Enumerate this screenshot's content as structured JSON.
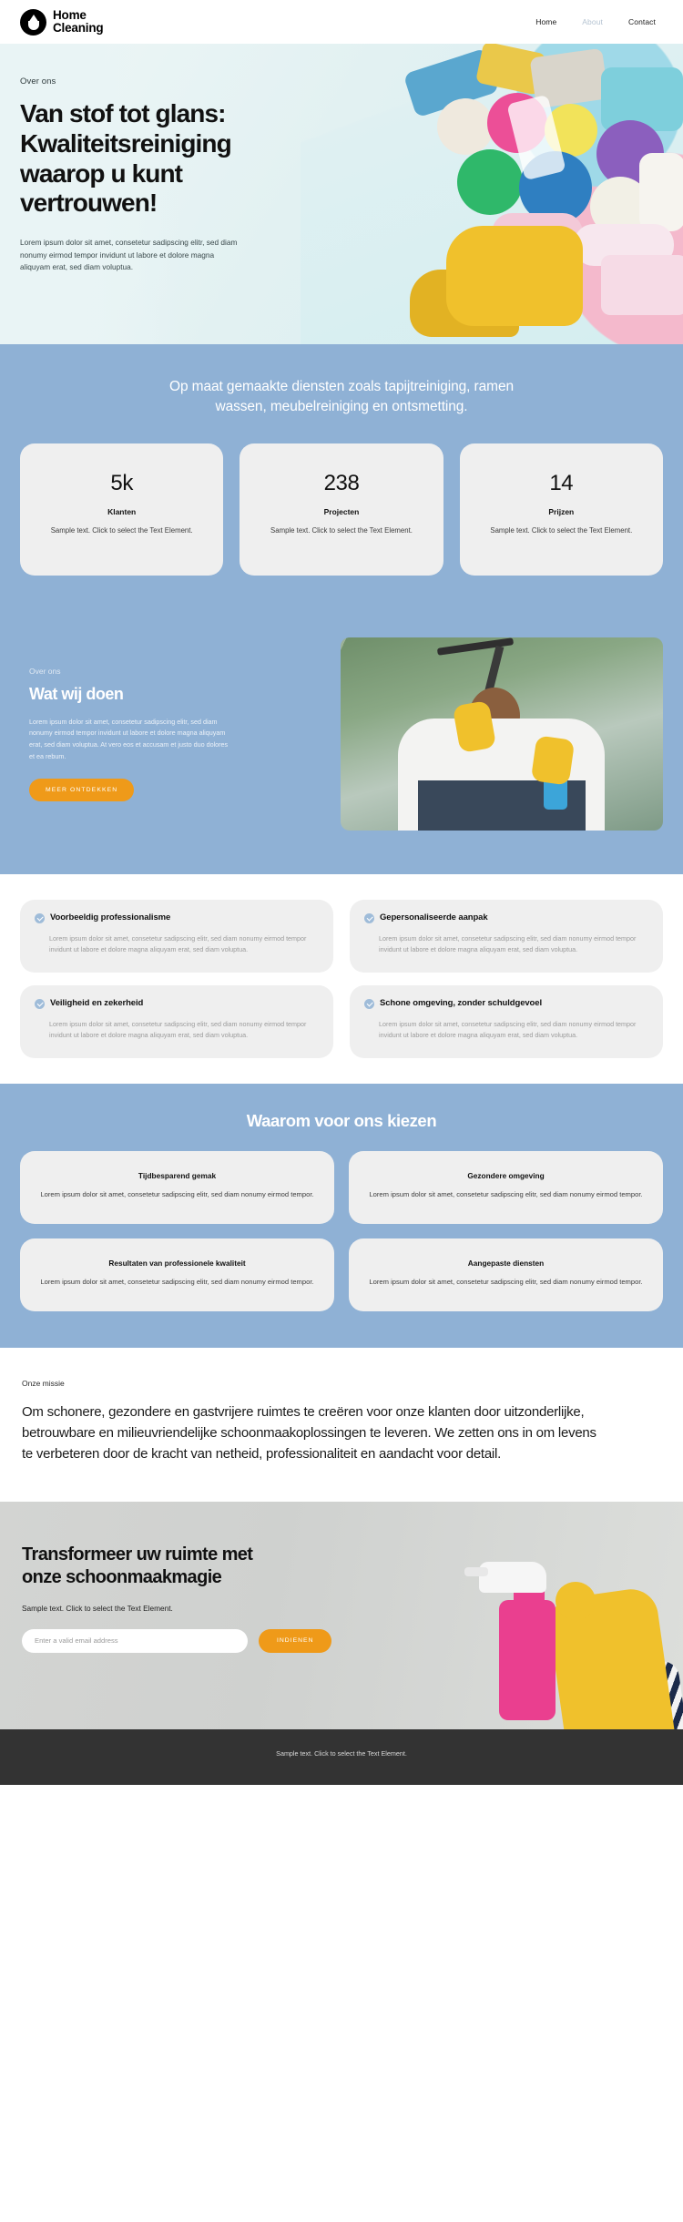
{
  "header": {
    "logo": {
      "line1": "Home",
      "line2": "Cleaning",
      "icon": "water-drop-icon"
    },
    "nav": [
      {
        "label": "Home",
        "active": false
      },
      {
        "label": "About",
        "active": true
      },
      {
        "label": "Contact",
        "active": false
      }
    ]
  },
  "hero": {
    "eyebrow": "Over ons",
    "title": "Van stof tot glans: Kwaliteitsreiniging waarop u kunt vertrouwen!",
    "paragraph": "Lorem ipsum dolor sit amet, consetetur sadipscing elitr, sed diam nonumy eirmod tempor invidunt ut labore et dolore magna aliquyam erat, sed diam voluptua."
  },
  "stats_band": {
    "title": "Op maat gemaakte diensten zoals tapijtreiniging, ramen wassen, meubelreiniging en ontsmetting.",
    "cards": [
      {
        "number": "5k",
        "label": "Klanten",
        "desc": "Sample text. Click to select the Text Element."
      },
      {
        "number": "238",
        "label": "Projecten",
        "desc": "Sample text. Click to select the Text Element."
      },
      {
        "number": "14",
        "label": "Prijzen",
        "desc": "Sample text. Click to select the Text Element."
      }
    ]
  },
  "about": {
    "eyebrow": "Over ons",
    "title": "Wat wij doen",
    "paragraph": "Lorem ipsum dolor sit amet, consetetur sadipscing elitr, sed diam nonumy eirmod tempor invidunt ut labore et dolore magna aliquyam erat, sed diam voluptua. At vero eos et accusam et justo duo dolores et ea rebum.",
    "button": "MEER ONTDEKKEN",
    "image": "window-cleaner-squeegee-photo"
  },
  "features": [
    {
      "title": "Voorbeeldig professionalisme",
      "body": "Lorem ipsum dolor sit amet, consetetur sadipscing elitr, sed diam nonumy eirmod tempor invidunt ut labore et dolore magna aliquyam erat, sed diam voluptua."
    },
    {
      "title": "Gepersonaliseerde aanpak",
      "body": "Lorem ipsum dolor sit amet, consetetur sadipscing elitr, sed diam nonumy eirmod tempor invidunt ut labore et dolore magna aliquyam erat, sed diam voluptua."
    },
    {
      "title": "Veiligheid en zekerheid",
      "body": "Lorem ipsum dolor sit amet, consetetur sadipscing elitr, sed diam nonumy eirmod tempor invidunt ut labore et dolore magna aliquyam erat, sed diam voluptua."
    },
    {
      "title": "Schone omgeving, zonder schuldgevoel",
      "body": "Lorem ipsum dolor sit amet, consetetur sadipscing elitr, sed diam nonumy eirmod tempor invidunt ut labore et dolore magna aliquyam erat, sed diam voluptua."
    }
  ],
  "why": {
    "title": "Waarom voor ons kiezen",
    "cards": [
      {
        "title": "Tijdbesparend gemak",
        "desc": "Lorem ipsum dolor sit amet, consetetur sadipscing elitr, sed diam nonumy eirmod tempor."
      },
      {
        "title": "Gezondere omgeving",
        "desc": "Lorem ipsum dolor sit amet, consetetur sadipscing elitr, sed diam nonumy eirmod tempor."
      },
      {
        "title": "Resultaten van professionele kwaliteit",
        "desc": "Lorem ipsum dolor sit amet, consetetur sadipscing elitr, sed diam nonumy eirmod tempor."
      },
      {
        "title": "Aangepaste diensten",
        "desc": "Lorem ipsum dolor sit amet, consetetur sadipscing elitr, sed diam nonumy eirmod tempor."
      }
    ]
  },
  "mission": {
    "eyebrow": "Onze missie",
    "text": "Om schonere, gezondere en gastvrijere ruimtes te creëren voor onze klanten door uitzonderlijke, betrouwbare en milieuvriendelijke schoonmaakoplossingen te leveren. We zetten ons in om levens te verbeteren door de kracht van netheid, professionaliteit en aandacht voor detail."
  },
  "cta": {
    "title": "Transformeer uw ruimte met onze schoonmaakmagie",
    "subtitle": "Sample text. Click to select the Text Element.",
    "email_placeholder": "Enter a valid email address",
    "email_value": "",
    "submit_label": "INDIENEN",
    "image": "spray-bottle-gloved-hand-photo"
  },
  "footer": {
    "text": "Sample text. Click to select the Text Element."
  },
  "colors": {
    "blue_band": "#8fb1d5",
    "orange_accent": "#ef9a19",
    "card_gray": "#efefef",
    "footer_dark": "#333333",
    "hero_mint": "#e2f1f2"
  }
}
